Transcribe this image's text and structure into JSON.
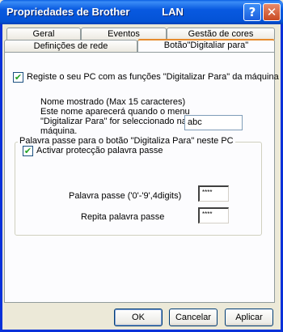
{
  "window": {
    "title": "Propriedades de Brother           LAN",
    "help_glyph": "?",
    "close_glyph": "✕"
  },
  "tabs": {
    "row_back": [
      "Geral",
      "Eventos",
      "Gestão de cores"
    ],
    "row_front": [
      "Definições de rede",
      "Botão\"Digitaliar para\""
    ],
    "active_index": 1
  },
  "panel": {
    "register_label": "Registe o seu PC com as funções \"Digitalizar Para\" da máquina",
    "register_checked": true,
    "name_desc_lines": [
      "Nome mostrado (Max 15 caracteres)",
      "Este nome aparecerá quando o menu",
      "\"Digitalizar Para\" for seleccionado na",
      "máquina."
    ],
    "name_value": "abc",
    "password_group": {
      "title": "Palavra passe para o botão \"Digitaliza Para\" neste PC",
      "activate_label": "Activar protecção palavra passe",
      "activate_checked": true,
      "password_label": "Palavra passe ('0'-'9',4digits)",
      "password_value": "****",
      "repeat_label": "Repita palavra passe",
      "repeat_value": "****"
    }
  },
  "buttons": {
    "ok": "OK",
    "cancel": "Cancelar",
    "apply": "Aplicar"
  },
  "check_glyph": "✔"
}
